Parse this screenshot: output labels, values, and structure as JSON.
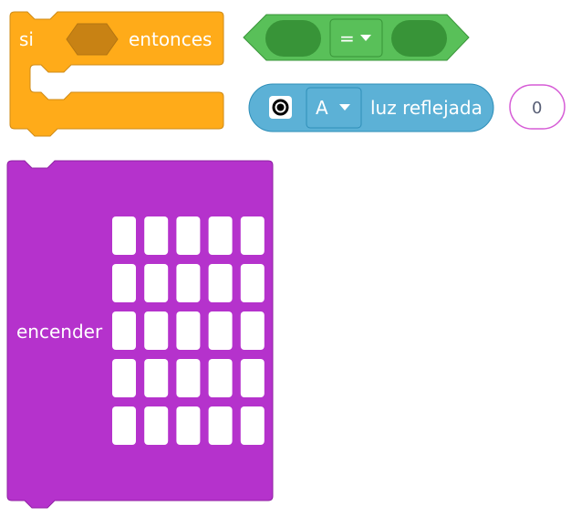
{
  "if_block": {
    "if_label": "si",
    "then_label": "entonces",
    "color": "#ffab19",
    "border": "#cf8b17",
    "slot_color": "#c88214"
  },
  "compare_block": {
    "operator": "=",
    "color": "#59c059",
    "border": "#389438",
    "slot_color": "#389438"
  },
  "sensor_block": {
    "button": "A",
    "label": "luz reflejada",
    "icon": "sensor-eye-icon",
    "color": "#5cb1d6",
    "border": "#2e8eb8"
  },
  "number_input": {
    "value": "0",
    "border": "#d65cd6"
  },
  "led_block": {
    "label": "encender",
    "color": "#b532cc",
    "border": "#9023a3",
    "rows": 5,
    "cols": 5
  }
}
